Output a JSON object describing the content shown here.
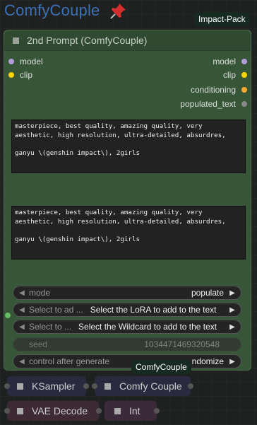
{
  "group": {
    "title": "ComfyCouple",
    "pin_icon": "pushpin-icon",
    "badge": "Impact-Pack"
  },
  "node": {
    "title": "2nd Prompt (ComfyCouple)",
    "inputs": [
      {
        "label": "model",
        "color": "#b39ddb"
      },
      {
        "label": "clip",
        "color": "#ffd500"
      }
    ],
    "outputs": [
      {
        "label": "model",
        "color": "#b39ddb"
      },
      {
        "label": "clip",
        "color": "#ffd500"
      },
      {
        "label": "conditioning",
        "color": "#ffa931"
      },
      {
        "label": "populated_text",
        "color": "#888888"
      }
    ],
    "text1": "masterpiece, best quality, amazing quality, very aesthetic, high resolution, ultra-detailed, absurdres,\n\nganyu \\(genshin impact\\), 2girls",
    "text2": "masterpiece, best quality, amazing quality, very aesthetic, high resolution, ultra-detailed, absurdres,\n\nganyu \\(genshin impact\\), 2girls",
    "widgets": {
      "mode_label": "mode",
      "mode_value": "populate",
      "lora_label": "Select to ad ...",
      "lora_value": "Select the LoRA to add to the text",
      "wildcard_label": "Select to ...",
      "wildcard_value": "Select the Wildcard to add to the text",
      "seed_label": "seed",
      "seed_value": "1034471469320548",
      "control_label": "control after generate",
      "control_value": "ndomize"
    },
    "footer_badge": "ComfyCouple"
  },
  "mini_nodes": [
    {
      "label": "KSampler"
    },
    {
      "label": "Comfy Couple"
    },
    {
      "label": "VAE Decode"
    },
    {
      "label": "Int"
    }
  ],
  "colors": {
    "node_bg": "#365637",
    "group_title": "#3d6fb4",
    "seed_link": "#66bb66"
  }
}
